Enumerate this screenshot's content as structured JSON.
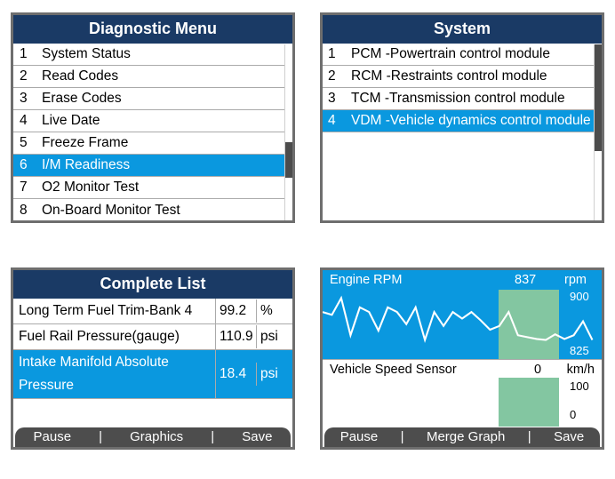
{
  "diagnostic_menu": {
    "title": "Diagnostic Menu",
    "items": [
      {
        "num": "1",
        "label": "System Status"
      },
      {
        "num": "2",
        "label": "Read Codes"
      },
      {
        "num": "3",
        "label": "Erase Codes"
      },
      {
        "num": "4",
        "label": "Live Date"
      },
      {
        "num": "5",
        "label": "Freeze Frame"
      },
      {
        "num": "6",
        "label": "I/M Readiness"
      },
      {
        "num": "7",
        "label": "O2 Monitor Test"
      },
      {
        "num": "8",
        "label": "On-Board Monitor Test"
      }
    ],
    "selected_index": 5
  },
  "system": {
    "title": "System",
    "items": [
      {
        "num": "1",
        "label": "PCM -Powertrain control module"
      },
      {
        "num": "2",
        "label": "RCM -Restraints control module"
      },
      {
        "num": "3",
        "label": "TCM -Transmission control module"
      },
      {
        "num": "4",
        "label": "VDM -Vehicle dynamics  control module"
      }
    ],
    "selected_index": 3
  },
  "complete_list": {
    "title": "Complete List",
    "rows": [
      {
        "name": "Long Term Fuel Trim-Bank 4",
        "value": "99.2",
        "unit": "%"
      },
      {
        "name": "Fuel Rail Pressure(gauge)",
        "value": "110.9",
        "unit": "psi"
      },
      {
        "name": "Intake Manifold Absolute Pressure",
        "value": "18.4",
        "unit": "psi"
      }
    ],
    "selected_index": 2,
    "footer": {
      "pause": "Pause",
      "graphics": "Graphics",
      "save": "Save"
    }
  },
  "graph_panel": {
    "graph1": {
      "name": "Engine RPM",
      "value": "837",
      "unit": "rpm",
      "ymax": "900",
      "ymin": "825"
    },
    "graph2": {
      "name": "Vehicle Speed Sensor",
      "value": "0",
      "unit": "km/h",
      "ymax": "100",
      "ymin": "0"
    },
    "footer": {
      "pause": "Pause",
      "merge": "Merge Graph",
      "save": "Save"
    }
  },
  "chart_data": [
    {
      "type": "line",
      "title": "Engine RPM",
      "ylabel": "rpm",
      "ylim": [
        825,
        900
      ],
      "x": [
        0,
        1,
        2,
        3,
        4,
        5,
        6,
        7,
        8,
        9,
        10,
        11,
        12,
        13,
        14,
        15,
        16,
        17,
        18,
        19,
        20,
        21,
        22,
        23,
        24,
        25,
        26,
        27,
        28,
        29
      ],
      "values": [
        875,
        870,
        895,
        840,
        880,
        870,
        845,
        880,
        870,
        850,
        880,
        835,
        870,
        850,
        870,
        860,
        870,
        858,
        845,
        850,
        870,
        840,
        838,
        836,
        834,
        842,
        836,
        840,
        860,
        835
      ]
    },
    {
      "type": "line",
      "title": "Vehicle Speed Sensor",
      "ylabel": "km/h",
      "ylim": [
        0,
        100
      ],
      "x": [
        0,
        1,
        2,
        3,
        4,
        5,
        6,
        7,
        8,
        9
      ],
      "values": [
        0,
        0,
        0,
        0,
        0,
        0,
        0,
        0,
        0,
        0
      ]
    }
  ]
}
